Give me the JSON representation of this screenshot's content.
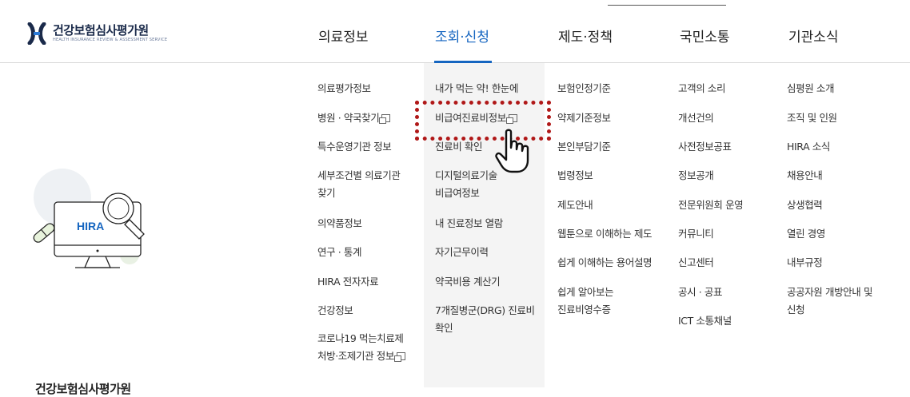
{
  "header": {
    "logo": {
      "title": "건강보험심사평가원",
      "subtitle": "HEALTH INSURANCE REVIEW & ASSESSMENT SERVICE"
    },
    "nav": [
      {
        "label": "의료정보"
      },
      {
        "label": "조회·신청"
      },
      {
        "label": "제도·정책"
      },
      {
        "label": "국민소통"
      },
      {
        "label": "기관소식"
      }
    ]
  },
  "side_panel": {
    "title": "건강보험심사평가원",
    "illustration_text": "HIRA"
  },
  "menu": {
    "col1": [
      "의료평가정보",
      "병원 · 약국찾기",
      "특수운영기관 정보",
      "세부조건별 의료기관",
      "찾기",
      "의약품정보",
      "연구 · 통계",
      "HIRA 전자자료",
      "건강정보",
      "코로나19 먹는치료제",
      "처방·조제기관 정보"
    ],
    "col2": [
      "내가 먹는 약! 한눈에",
      "비급여진료비정보",
      "진료비 확인",
      "디지털의료기술",
      "비급여정보",
      "내 진료정보 열람",
      "자기근무이력",
      "약국비용 계산기",
      "7개질병군(DRG) 진료비",
      "확인"
    ],
    "col3": [
      "보험인정기준",
      "약제기준정보",
      "본인부담기준",
      "법령정보",
      "제도안내",
      "웹툰으로 이해하는 제도",
      "쉽게 이해하는 용어설명",
      "쉽게 알아보는",
      "진료비영수증"
    ],
    "col4": [
      "고객의 소리",
      "개선건의",
      "사전정보공표",
      "정보공개",
      "전문위원회 운영",
      "커뮤니티",
      "신고센터",
      "공시 · 공표",
      "ICT 소통채널"
    ],
    "col5": [
      "심평원 소개",
      "조직 및 인원",
      "HIRA 소식",
      "채용안내",
      "상생협력",
      "열린 경영",
      "내부규정",
      "공공자원 개방안내 및",
      "신청"
    ]
  },
  "colors": {
    "accent": "#1565c0",
    "highlight": "#b01818"
  }
}
